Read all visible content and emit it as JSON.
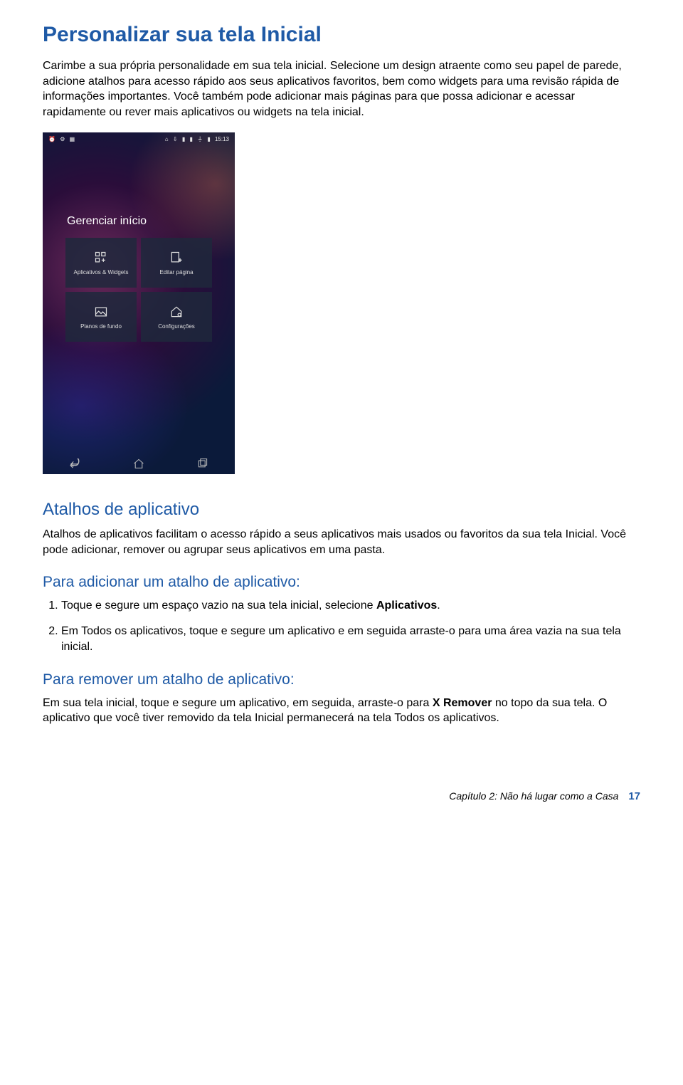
{
  "title": "Personalizar sua tela Inicial",
  "intro_p1": "Carimbe a sua própria personalidade em sua tela inicial. Selecione um design atraente como seu papel de parede, adicione atalhos para acesso rápido aos seus aplicativos favoritos, bem como widgets para uma revisão rápida de informações importantes. Você também pode adicionar mais páginas para que possa adicionar e acessar rapidamente ou rever mais aplicativos ou widgets na tela inicial.",
  "phone": {
    "status_time": "15:13",
    "status_left_icons": [
      "alarm-icon",
      "settings-icon",
      "app-icon"
    ],
    "status_right_icons": [
      "home-icon",
      "download-icon",
      "signal-icon",
      "signal-icon",
      "wifi-icon",
      "battery-icon"
    ],
    "manage_title": "Gerenciar início",
    "tiles": [
      {
        "label": "Aplicativos & Widgets",
        "icon": "grid-plus-icon"
      },
      {
        "label": "Editar página",
        "icon": "page-plus-icon"
      },
      {
        "label": "Planos de fundo",
        "icon": "image-icon"
      },
      {
        "label": "Configurações",
        "icon": "home-gear-icon"
      }
    ],
    "nav": [
      "back-icon",
      "home-icon",
      "recent-icon"
    ]
  },
  "section2_title": "Atalhos de aplicativo",
  "section2_p": "Atalhos de aplicativos facilitam o acesso rápido a seus aplicativos mais usados ou favoritos da sua tela Inicial. Você pode adicionar, remover ou agrupar seus aplicativos em uma pasta.",
  "sub_add_title": "Para adicionar um atalho de aplicativo:",
  "steps_add": [
    {
      "pre": "Toque e segure um espaço vazio na sua tela inicial, selecione ",
      "bold": "Aplicativos",
      "post": "."
    },
    {
      "pre": "Em Todos os aplicativos, toque e segure um aplicativo e em seguida arraste-o para uma área vazia na sua tela inicial.",
      "bold": "",
      "post": ""
    }
  ],
  "sub_remove_title": "Para remover um atalho de aplicativo:",
  "remove_p_pre": "Em sua tela inicial, toque e segure um aplicativo, em seguida, arraste-o para ",
  "remove_p_bold": "X Remover",
  "remove_p_post": " no topo da sua tela. O aplicativo que você tiver removido da tela Inicial permanecerá na tela Todos os aplicativos.",
  "footer_chapter": "Capítulo 2:  Não há lugar como a Casa",
  "footer_page": "17"
}
